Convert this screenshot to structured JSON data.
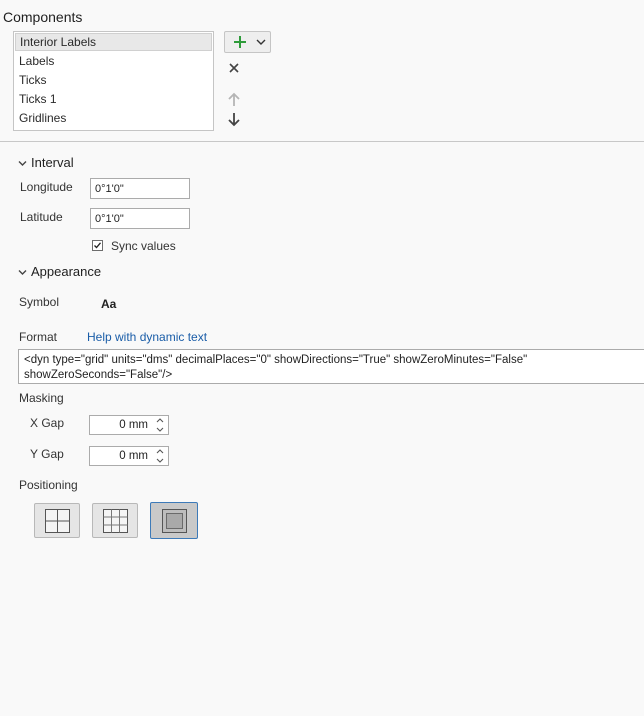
{
  "components": {
    "title": "Components",
    "items": [
      "Interior Labels",
      "Labels",
      "Ticks",
      "Ticks 1",
      "Gridlines"
    ],
    "selected_index": 0,
    "add_icon": "plus-icon",
    "remove_icon": "close-icon",
    "move_up_icon": "arrow-up-icon",
    "move_down_icon": "arrow-down-icon"
  },
  "interval": {
    "title": "Interval",
    "longitude_label": "Longitude",
    "longitude_value": "0°1'0\"",
    "latitude_label": "Latitude",
    "latitude_value": "0°1'0\"",
    "sync_label": "Sync values",
    "sync_checked": true
  },
  "appearance": {
    "title": "Appearance",
    "symbol_label": "Symbol",
    "symbol_preview": "Aa",
    "format_label": "Format",
    "help_link": "Help with dynamic text",
    "format_text": "<dyn type=\"grid\" units=\"dms\" decimalPlaces=\"0\" showDirections=\"True\" showZeroMinutes=\"False\" showZeroSeconds=\"False\"/>",
    "masking_label": "Masking",
    "x_gap_label": "X Gap",
    "x_gap_value": "0 mm",
    "y_gap_label": "Y Gap",
    "y_gap_value": "0 mm",
    "positioning_label": "Positioning",
    "positioning_options": [
      "pos-center-cross-icon",
      "pos-grid-icon",
      "pos-inside-border-icon"
    ],
    "positioning_selected": 2
  },
  "colors": {
    "add_green": "#2e9b3a",
    "link_blue": "#1a5da8",
    "selected_border": "#3d7ab8"
  }
}
